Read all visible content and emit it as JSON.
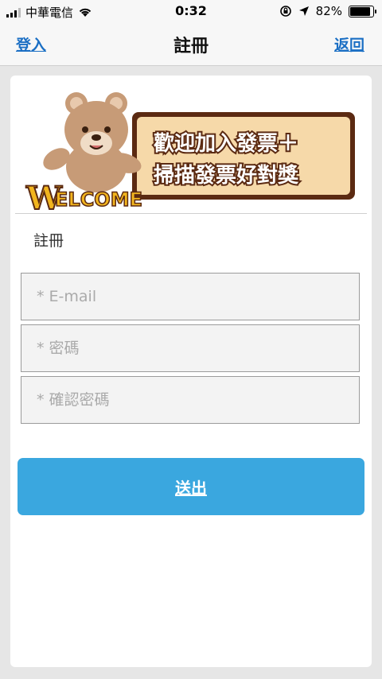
{
  "status": {
    "carrier": "中華電信",
    "time": "0:32",
    "battery": "82%"
  },
  "nav": {
    "left": "登入",
    "title": "註冊",
    "right": "返回"
  },
  "banner": {
    "logo_text": "WELCOME",
    "line1": "歡迎加入發票＋",
    "line2": "掃描發票好對獎"
  },
  "form": {
    "section_label": "註冊",
    "email_placeholder": "* E-mail",
    "password_placeholder": "* 密碼",
    "confirm_placeholder": "* 確認密碼",
    "submit_label": "送出"
  }
}
